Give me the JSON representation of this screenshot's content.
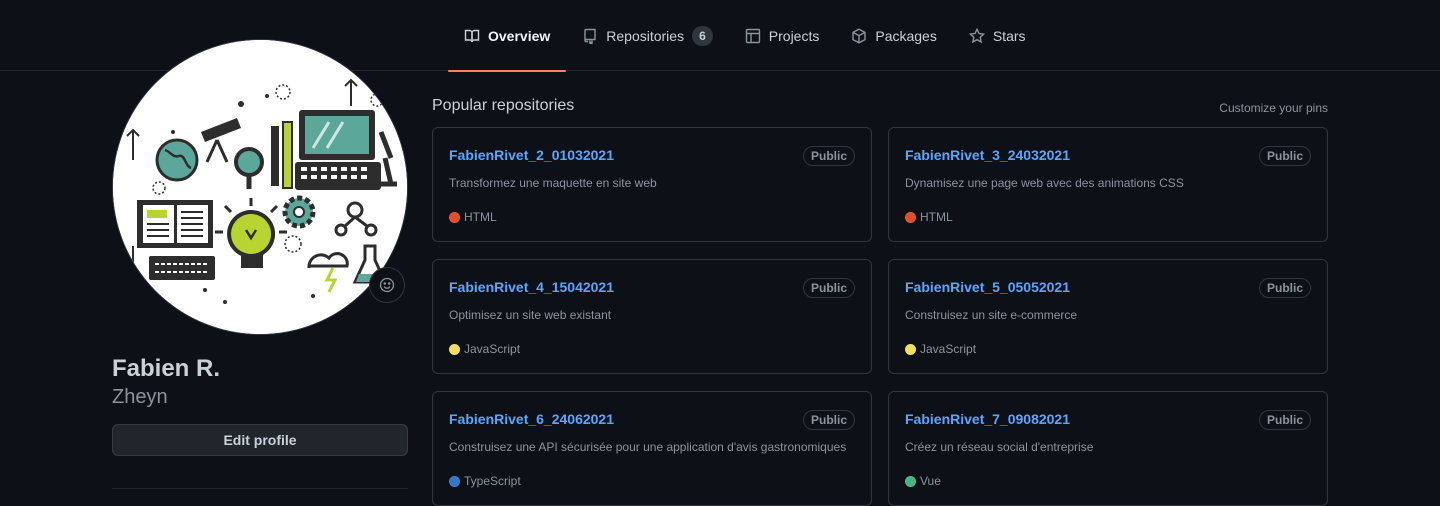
{
  "nav": {
    "tabs": [
      {
        "label": "Overview",
        "icon": "book-icon",
        "selected": true
      },
      {
        "label": "Repositories",
        "icon": "repo-icon",
        "count": "6"
      },
      {
        "label": "Projects",
        "icon": "table-icon"
      },
      {
        "label": "Packages",
        "icon": "package-icon"
      },
      {
        "label": "Stars",
        "icon": "star-icon"
      }
    ]
  },
  "profile": {
    "fullname": "Fabien R.",
    "username": "Zheyn",
    "edit_label": "Edit profile",
    "avatar_icon": "science-education-illustration",
    "status_icon": "smiley-icon"
  },
  "pinned": {
    "title": "Popular repositories",
    "customize_label": "Customize your pins",
    "repos": [
      {
        "name": "FabienRivet_2_01032021",
        "visibility": "Public",
        "description": "Transformez une maquette en site web",
        "language": "HTML",
        "lang_color": "#e34c26"
      },
      {
        "name": "FabienRivet_3_24032021",
        "visibility": "Public",
        "description": "Dynamisez une page web avec des animations CSS",
        "language": "HTML",
        "lang_color": "#e34c26"
      },
      {
        "name": "FabienRivet_4_15042021",
        "visibility": "Public",
        "description": "Optimisez un site web existant",
        "language": "JavaScript",
        "lang_color": "#f1e05a"
      },
      {
        "name": "FabienRivet_5_05052021",
        "visibility": "Public",
        "description": "Construisez un site e-commerce",
        "language": "JavaScript",
        "lang_color": "#f1e05a"
      },
      {
        "name": "FabienRivet_6_24062021",
        "visibility": "Public",
        "description": "Construisez une API sécurisée pour une application d'avis gastronomiques",
        "language": "TypeScript",
        "lang_color": "#3178c6"
      },
      {
        "name": "FabienRivet_7_09082021",
        "visibility": "Public",
        "description": "Créez un réseau social d'entreprise",
        "language": "Vue",
        "lang_color": "#41b883"
      }
    ]
  },
  "colors": {
    "background": "#0d1117",
    "link": "#58a6ff",
    "selected_tab_underline": "#f78166"
  }
}
